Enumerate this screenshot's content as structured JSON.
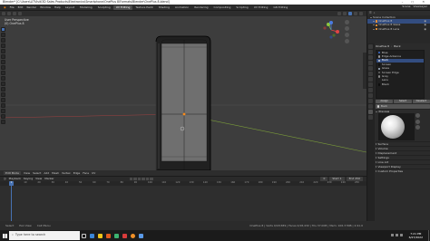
{
  "title_bar": {
    "title": "Blender* [C:\\Users\\LITVisit\\3D Sales Products\\Electronics\\Smartphone\\OnePlus 8\\Formats\\Blender\\OnePlus 8.blend]",
    "controls": "–  □  ✕"
  },
  "top_menu": [
    "File",
    "Edit",
    "Render",
    "Window",
    "Help"
  ],
  "workspace_tabs": [
    {
      "label": "Layout",
      "active": false
    },
    {
      "label": "Modeling",
      "active": false
    },
    {
      "label": "Sculpting",
      "active": false
    },
    {
      "label": "UV Editing",
      "active": true
    },
    {
      "label": "Texture Paint",
      "active": false
    },
    {
      "label": "Shading",
      "active": false
    },
    {
      "label": "Animation",
      "active": false
    },
    {
      "label": "Rendering",
      "active": false
    },
    {
      "label": "Compositing",
      "active": false
    },
    {
      "label": "Scripting",
      "active": false
    },
    {
      "label": "UV Editing",
      "active": false
    },
    {
      "label": "GN Editing",
      "active": false
    }
  ],
  "top_right": {
    "scene": "Scene",
    "view_layer": "ViewLayer"
  },
  "viewport": {
    "line1": "User Perspective",
    "line2": "(0) OnePlus 8"
  },
  "outliner": {
    "header": "Scene Collection",
    "rows": [
      {
        "label": "Scene Collection",
        "selected": false
      },
      {
        "label": "OnePlus 8",
        "selected": true
      },
      {
        "label": "OnePlus 8 Glass",
        "selected": false
      },
      {
        "label": "OnePlus 8 Lens",
        "selected": false
      }
    ]
  },
  "properties": {
    "object_label": "OnePlus 8",
    "mode_label": "Back",
    "materials": [
      {
        "name": "Blue",
        "color": "#3b6fd8"
      },
      {
        "name": "Edge Antenna",
        "color": "#9a9a9a"
      },
      {
        "name": "Back",
        "color": "#d0d0d0",
        "selected": true
      },
      {
        "name": "Screen",
        "color": "#111111"
      },
      {
        "name": "Glass",
        "color": "#aab8c8"
      },
      {
        "name": "Screen Edge",
        "color": "#666666"
      },
      {
        "name": "Gray",
        "color": "#888888"
      },
      {
        "name": "Lens",
        "color": "#222222"
      },
      {
        "name": "Black",
        "color": "#0c0c0c"
      }
    ],
    "buttons": [
      "Assign",
      "Select",
      "Deselect"
    ],
    "material_field": "Back",
    "preview_label": "Preview",
    "sections": [
      "Surface",
      "Volume",
      "Displacement",
      "Settings",
      "Line Art",
      "Viewport Display",
      "Custom Properties"
    ]
  },
  "viewport_footer": [
    "Edit Mode",
    "View",
    "Select",
    "Add",
    "Mesh",
    "Vertex",
    "Edge",
    "Face",
    "UV"
  ],
  "timeline_header": {
    "menus": [
      "Playback",
      "Keying",
      "View",
      "Marker"
    ],
    "current": "0",
    "start_label": "Start",
    "start": "1",
    "end_label": "End",
    "end": "250"
  },
  "frame_numbers": [
    "0",
    "10",
    "20",
    "30",
    "40",
    "50",
    "60",
    "70",
    "80",
    "90",
    "100",
    "110",
    "120",
    "130",
    "140",
    "150",
    "160",
    "170",
    "180",
    "190",
    "200",
    "210",
    "220",
    "230",
    "240",
    "250"
  ],
  "status_bar": {
    "items": [
      "Select",
      "Pan View",
      "Call Menu"
    ],
    "stats": "OnePlus 8 | Verts 0/18,589 | Faces 0/18,432 | Tris 37,008 | Mem: 106.3 MiB | 2.91.0"
  },
  "taskbar": {
    "search_placeholder": "Type here to search",
    "time": "7:21 PM",
    "date": "6/27/2022",
    "app_colors": [
      "#3a86d8",
      "#f0c419",
      "#e05a1e",
      "#3cb371",
      "#d83b3b",
      "#f09028",
      "#5a9ae8"
    ]
  }
}
